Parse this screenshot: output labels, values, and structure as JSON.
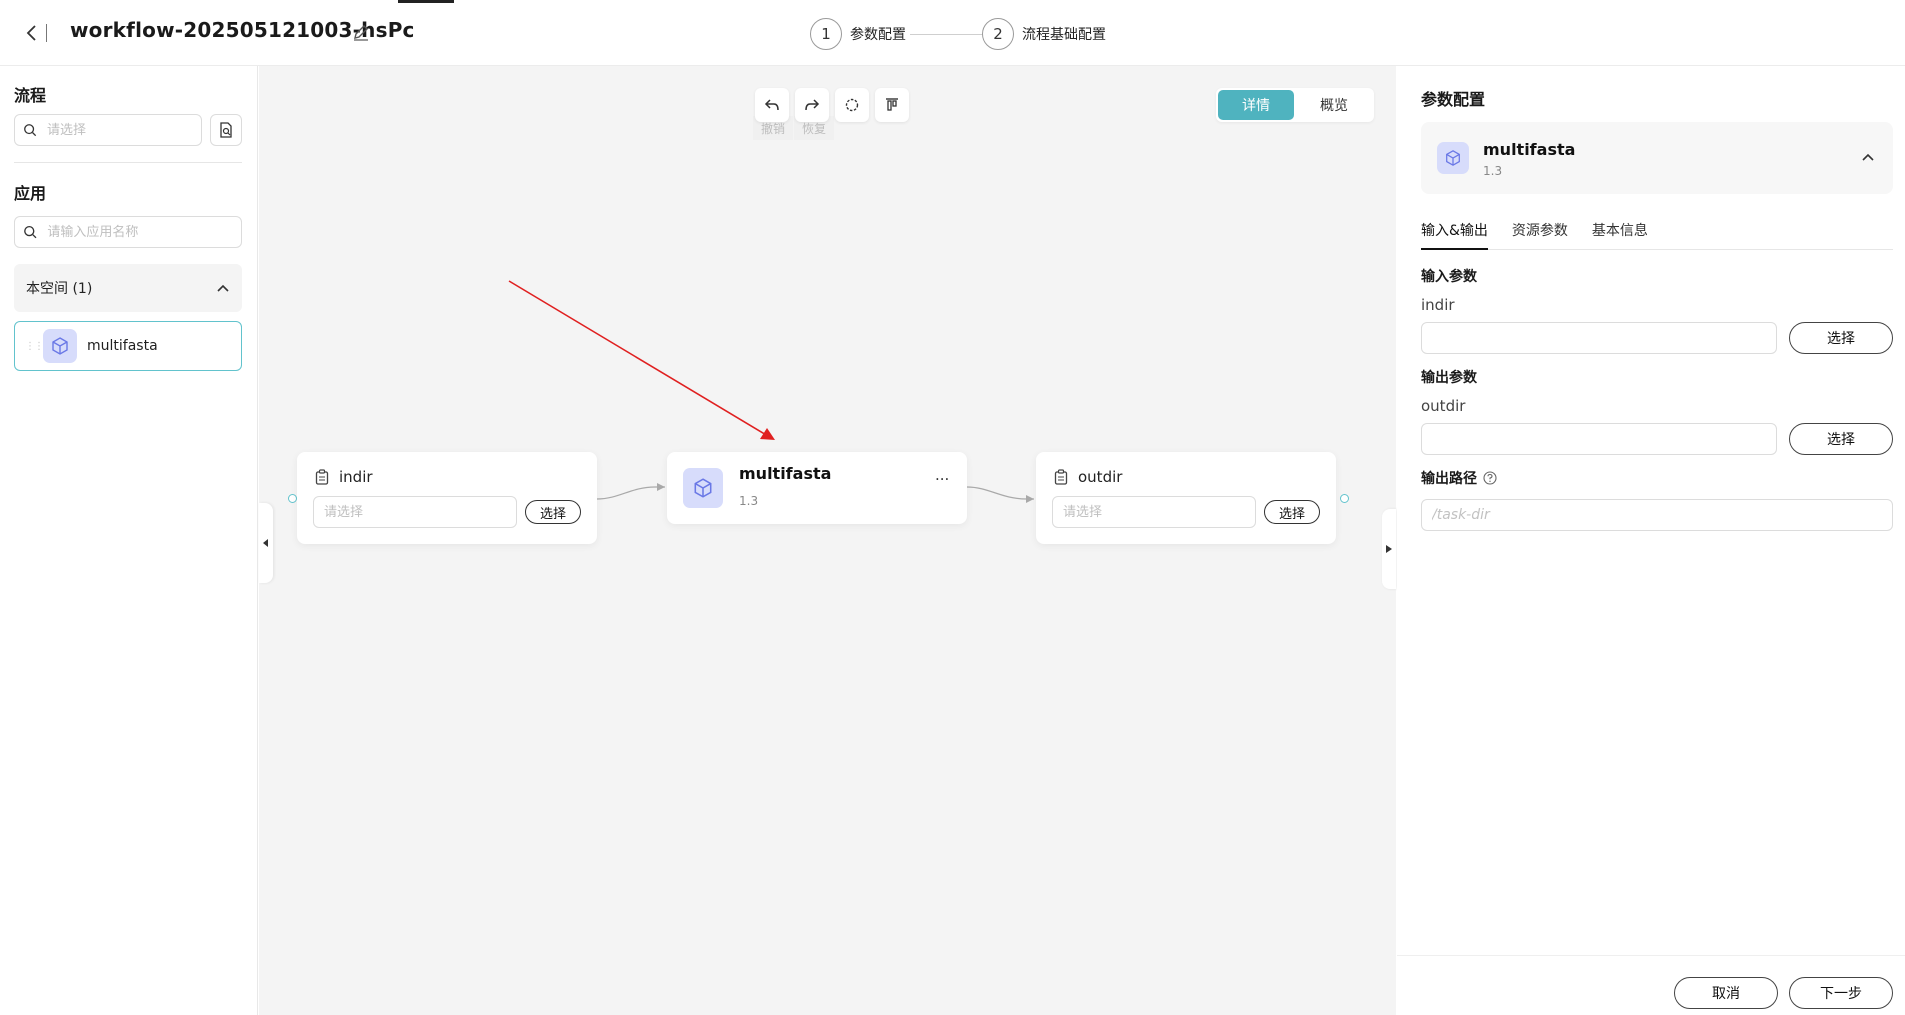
{
  "header": {
    "title": "workflow-202505121003-hsPc",
    "steps": [
      {
        "number": "1",
        "label": "参数配置"
      },
      {
        "number": "2",
        "label": "流程基础配置"
      }
    ]
  },
  "sidebar": {
    "flow_title": "流程",
    "flow_search_placeholder": "请选择",
    "app_title": "应用",
    "app_search_placeholder": "请输入应用名称",
    "group_label": "本空间 (1)",
    "app_item_label": "multifasta"
  },
  "canvas": {
    "toolbar_tips": {
      "undo": "撤销",
      "redo": "恢复"
    },
    "view_toggle": {
      "detail": "详情",
      "overview": "概览"
    },
    "input_node": {
      "label": "indir",
      "placeholder": "请选择",
      "button": "选择"
    },
    "app_node": {
      "name": "multifasta",
      "version": "1.3",
      "menu": "..."
    },
    "output_node": {
      "label": "outdir",
      "placeholder": "请选择",
      "button": "选择"
    }
  },
  "panel": {
    "title": "参数配置",
    "app_name": "multifasta",
    "app_version": "1.3",
    "tabs": [
      "输入&输出",
      "资源参数",
      "基本信息"
    ],
    "input_section": "输入参数",
    "input_param": "indir",
    "input_select": "选择",
    "output_section": "输出参数",
    "output_param": "outdir",
    "output_select": "选择",
    "path_label": "输出路径",
    "path_placeholder": "/task-dir",
    "cancel": "取消",
    "next": "下一步"
  },
  "colors": {
    "accent": "#4fb3bf",
    "port": "#62c3cd",
    "app_icon_bg": "#d7dcfb",
    "app_icon_stroke": "#6a78e6",
    "annotation_arrow": "#e02020"
  }
}
